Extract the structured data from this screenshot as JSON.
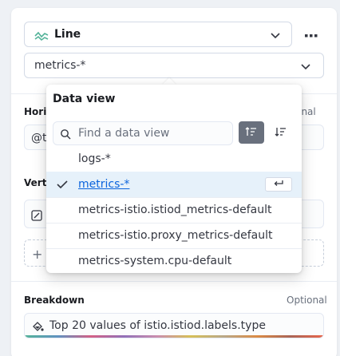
{
  "chart_type": {
    "icon": "line-chart-icon",
    "label": "Line"
  },
  "more_icon": "ellipsis-icon",
  "data_view_select": {
    "value": "metrics-*"
  },
  "horizontal_axis": {
    "label_partial": "Horiz",
    "optional": "Optional",
    "value_partial": "@ti"
  },
  "vertical_axis": {
    "label_partial": "Verti"
  },
  "breakdown": {
    "label": "Breakdown",
    "optional": "Optional",
    "value": "Top 20 values of istio.istiod.labels.type",
    "icon": "paint-bucket-icon"
  },
  "popover": {
    "title": "Data view",
    "search_placeholder": "Find a data view",
    "sort_asc_icon": "sort-ascending-icon",
    "sort_desc_icon": "sort-descending-icon",
    "items": [
      {
        "label": "logs-*",
        "selected": false
      },
      {
        "label": "metrics-*",
        "selected": true
      },
      {
        "label": "metrics-istio.istiod_metrics-default",
        "selected": false
      },
      {
        "label": "metrics-istio.proxy_metrics-default",
        "selected": false
      },
      {
        "label": "metrics-system.cpu-default",
        "selected": false
      }
    ]
  },
  "colors": {
    "accent": "#0b64dd",
    "selected_bg": "#e6f1fa",
    "line_icon": "#54b399"
  }
}
